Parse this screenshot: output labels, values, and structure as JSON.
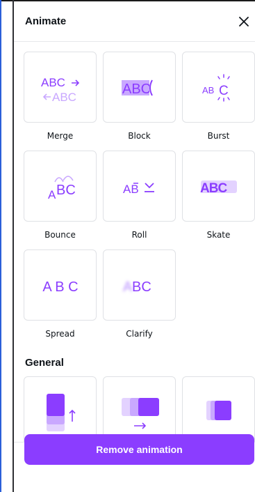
{
  "panel": {
    "title": "Animate",
    "close_icon": "close-icon"
  },
  "text_animations": [
    {
      "label": "Merge"
    },
    {
      "label": "Block"
    },
    {
      "label": "Burst"
    },
    {
      "label": "Bounce"
    },
    {
      "label": "Roll"
    },
    {
      "label": "Skate"
    },
    {
      "label": "Spread"
    },
    {
      "label": "Clarify"
    }
  ],
  "previews": {
    "merge_top": "ABC",
    "merge_bottom": "ABC",
    "block": "ABC",
    "burst": "ABC",
    "bounce_a": "A",
    "bounce_bc": "BC",
    "roll": "AB",
    "skate": "ABC",
    "spread": "A B C",
    "clarify": "ABC"
  },
  "general": {
    "title": "General",
    "tiles": [
      "rise-icon",
      "pan-icon",
      "fade-icon"
    ]
  },
  "footer": {
    "remove_label": "Remove animation"
  },
  "colors": {
    "accent": "#8b3dff",
    "accent_light": "#c9a8ff",
    "accent_lighter": "#e3d2ff"
  }
}
